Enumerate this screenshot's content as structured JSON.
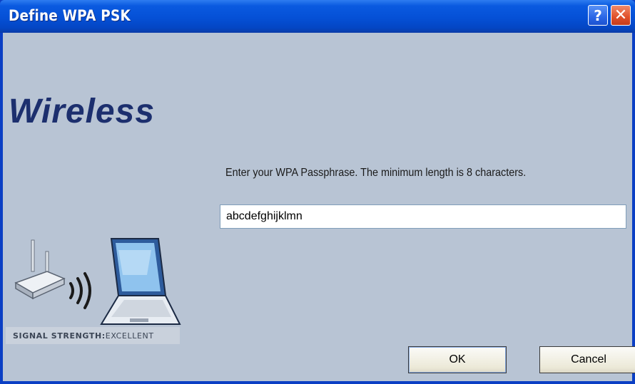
{
  "window": {
    "title": "Define WPA PSK",
    "help_glyph": "?",
    "close_glyph": "✕"
  },
  "brand": {
    "text": "Wireless"
  },
  "form": {
    "prompt": "Enter your WPA Passphrase.  The minimum length is 8 characters.",
    "passphrase_value": "abcdefghijklmn"
  },
  "signal": {
    "label": "SIGNAL STRENGTH:",
    "value": "EXCELLENT"
  },
  "buttons": {
    "ok_label": "OK",
    "cancel_label": "Cancel"
  },
  "icons": {
    "router": "router-icon",
    "waves": "signal-waves-icon",
    "laptop": "laptop-icon"
  },
  "colors": {
    "titlebar": "#0550d6",
    "client_background": "#b8c4d4",
    "brand_text": "#1c2f6e"
  }
}
